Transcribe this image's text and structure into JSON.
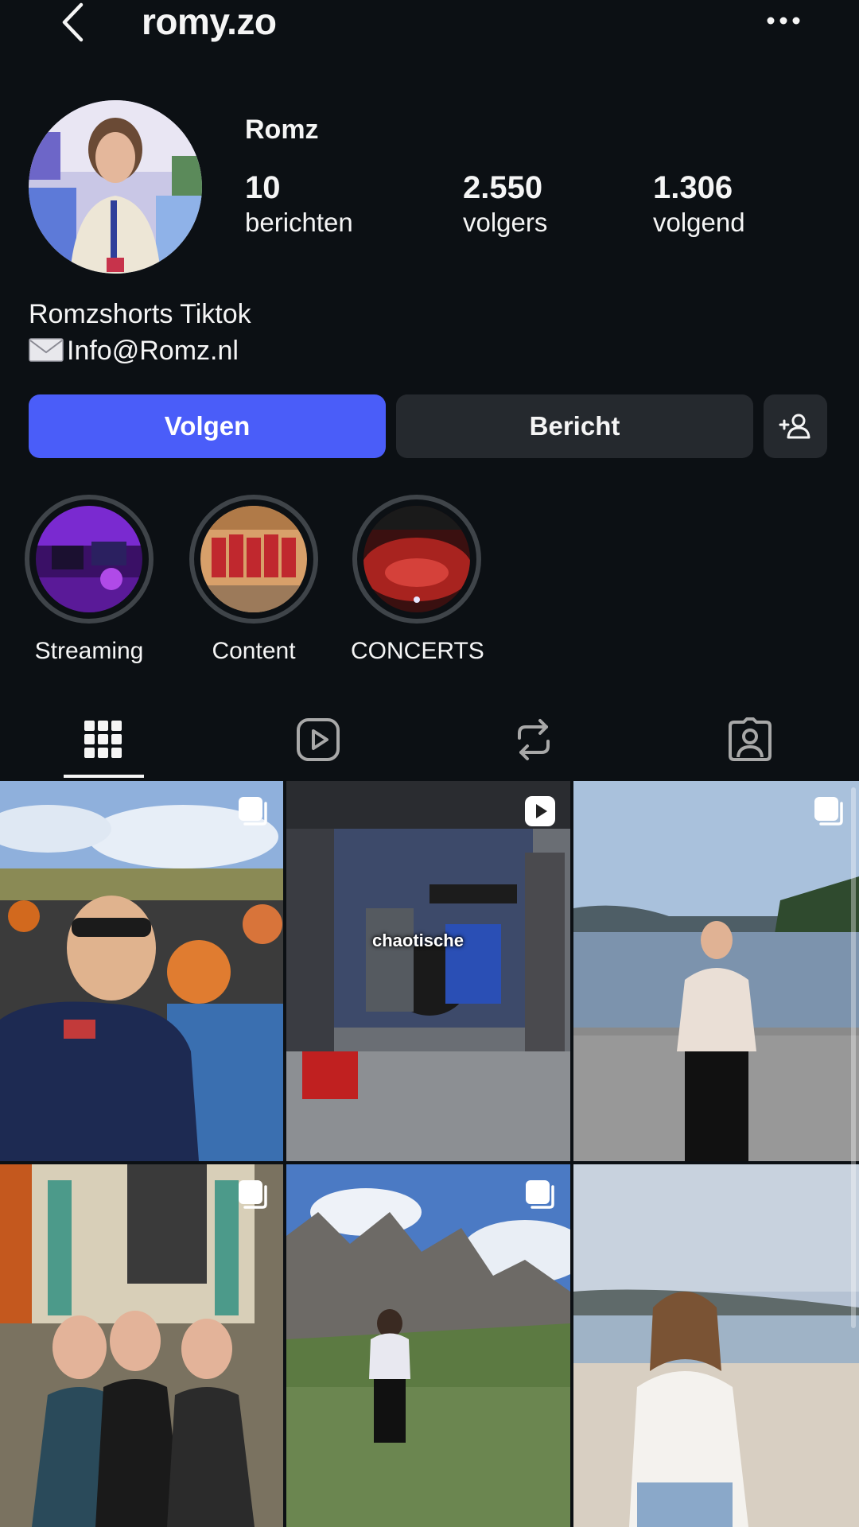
{
  "header": {
    "username": "romy.zo"
  },
  "profile": {
    "display_name": "Romz",
    "stats": [
      {
        "value": "10",
        "label": "berichten"
      },
      {
        "value": "2.550",
        "label": "volgers"
      },
      {
        "value": "1.306",
        "label": "volgend"
      }
    ],
    "bio_line_1": "Romzshorts Tiktok",
    "bio_line_2": "Info@Romz.nl"
  },
  "actions": {
    "follow_label": "Volgen",
    "message_label": "Bericht"
  },
  "highlights": [
    {
      "label": "Streaming"
    },
    {
      "label": "Content"
    },
    {
      "label": "CONCERTS"
    }
  ],
  "tabs": [
    {
      "name": "posts-grid",
      "icon": "grid-icon",
      "active": true
    },
    {
      "name": "reels",
      "icon": "reels-icon",
      "active": false
    },
    {
      "name": "reposts",
      "icon": "repost-icon",
      "active": false
    },
    {
      "name": "tagged",
      "icon": "tagged-icon",
      "active": false
    }
  ],
  "posts": [
    {
      "badge": "carousel-icon"
    },
    {
      "badge": "reel-icon",
      "overlay_text": "chaotische"
    },
    {
      "badge": "carousel-icon"
    },
    {
      "badge": "carousel-icon"
    },
    {
      "badge": "carousel-icon"
    },
    {
      "badge": ""
    }
  ],
  "colors": {
    "background": "#0c1014",
    "follow_button": "#4a5df9",
    "secondary_button": "#25292e"
  }
}
